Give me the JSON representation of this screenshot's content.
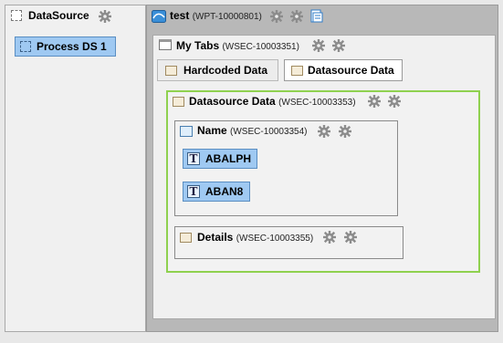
{
  "left_panel": {
    "title": "DataSource",
    "process_item": "Process DS 1"
  },
  "right_panel": {
    "title": "test",
    "title_id": "(WPT-10000801)",
    "tabs_widget": {
      "title": "My Tabs",
      "id": "(WSEC-10003351)",
      "tabs": [
        {
          "label": "Hardcoded Data"
        },
        {
          "label": "Datasource Data"
        }
      ]
    },
    "datasource_section": {
      "title": "Datasource Data",
      "id": "(WSEC-10003353)"
    },
    "name_section": {
      "title": "Name",
      "id": "(WSEC-10003354)",
      "fields": [
        "ABALPH",
        "ABAN8"
      ]
    },
    "details_section": {
      "title": "Details",
      "id": "(WSEC-10003355)"
    }
  },
  "icons": {
    "gear": "gear-icon",
    "section": "section-icon",
    "text_field": "text-field-icon",
    "page": "page-icon"
  },
  "colors": {
    "selected_item_bg": "#9fc9f2",
    "selected_border": "#5a8ec2",
    "active_section_border": "#8fd14f"
  }
}
